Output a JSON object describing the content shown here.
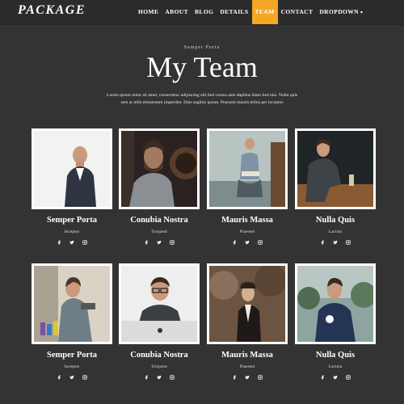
{
  "brand": {
    "logo": "PACKAGE"
  },
  "nav": {
    "items": [
      {
        "label": "HOME",
        "name": "nav-home"
      },
      {
        "label": "ABOUT",
        "name": "nav-about"
      },
      {
        "label": "BLOG",
        "name": "nav-blog"
      },
      {
        "label": "DETAILS",
        "name": "nav-details"
      },
      {
        "label": "TEAM",
        "name": "nav-team"
      },
      {
        "label": "CONTACT",
        "name": "nav-contact"
      },
      {
        "label": "DROPDOWN",
        "name": "nav-dropdown"
      }
    ],
    "active": "TEAM",
    "caret": "▾"
  },
  "section": {
    "eyebrow": "Semper Porta",
    "title": "My Team",
    "description": "Lorem ipsum dolor sit amet, consectetur adipiscing elit.Sed cursus ante dapibus diam Sed nisi. Nulla quis sem at nibh elementum imperdiet. Duis sagittis ipsum. Praesent mauris.tellus per inceptos"
  },
  "team": [
    {
      "name": "Semper Porta",
      "role": "Inceptos"
    },
    {
      "name": "Conubia Nostra",
      "role": "Torquent"
    },
    {
      "name": "Mauris Massa",
      "role": "Praesent"
    },
    {
      "name": "Nulla Quis",
      "role": "Lacinia"
    },
    {
      "name": "Semper Porta",
      "role": "Inceptos"
    },
    {
      "name": "Conubia Nostra",
      "role": "Torquent"
    },
    {
      "name": "Mauris Massa",
      "role": "Praesent"
    },
    {
      "name": "Nulla Quis",
      "role": "Lacinia"
    }
  ],
  "social_icons": [
    "facebook-icon",
    "twitter-icon",
    "instagram-icon"
  ],
  "colors": {
    "background": "#333333",
    "navbar": "#2b2b2b",
    "accent": "#f5a623",
    "text": "#ffffff"
  }
}
